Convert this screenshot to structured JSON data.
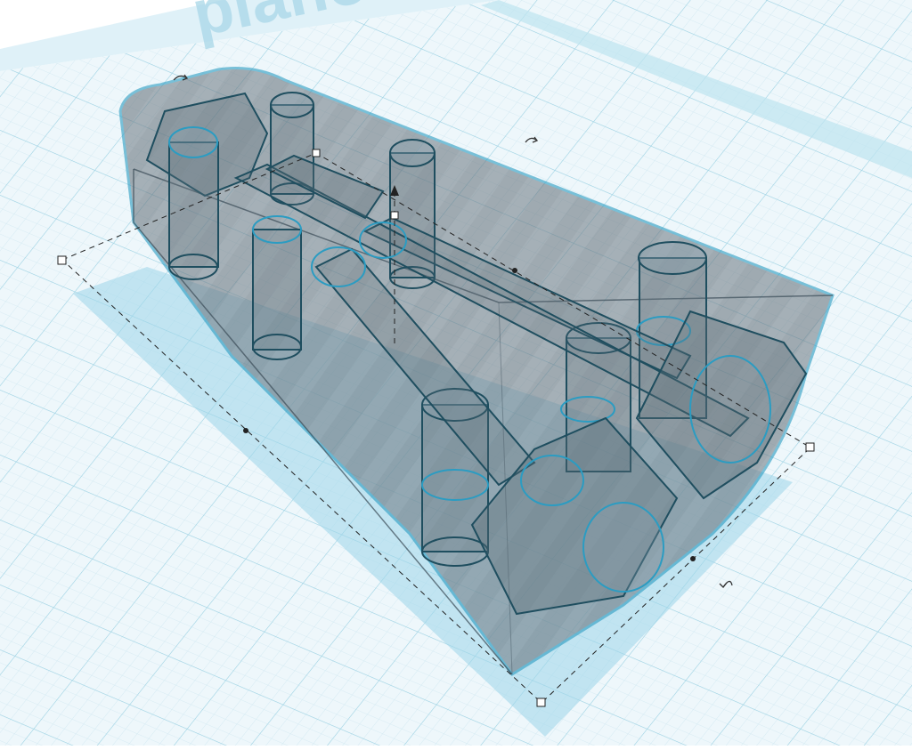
{
  "workplane": {
    "watermark_text": "plano de tr",
    "grid_color": "#bfe3ee",
    "grid_major_color": "#94cfe2",
    "edge_color": "#a8dcec"
  },
  "model": {
    "selection_color": "#2b9cc2",
    "fill_color": "#5b6a74",
    "hole_stroke": "#1f4e5f"
  },
  "handles": {
    "rotate_icon": "rotate-arrow-icon",
    "lift_icon": "lift-cone-icon",
    "corner_icon": "resize-square-handle",
    "midpoint_icon": "resize-dot-handle"
  }
}
